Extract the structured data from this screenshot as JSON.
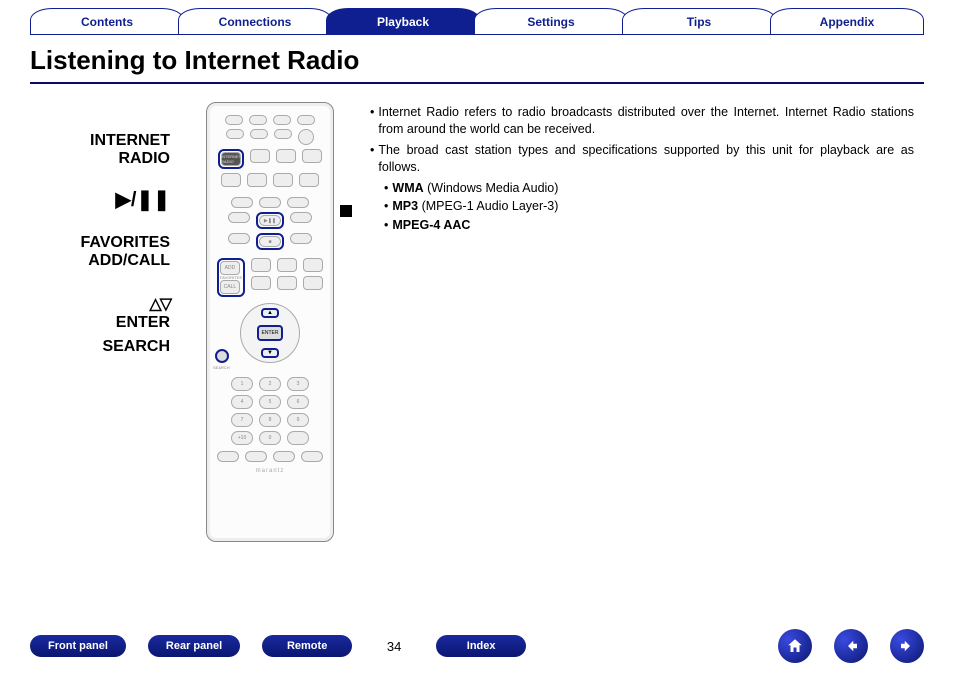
{
  "tabs": [
    {
      "label": "Contents",
      "active": false
    },
    {
      "label": "Connections",
      "active": false
    },
    {
      "label": "Playback",
      "active": true
    },
    {
      "label": "Settings",
      "active": false
    },
    {
      "label": "Tips",
      "active": false
    },
    {
      "label": "Appendix",
      "active": false
    }
  ],
  "title": "Listening to Internet Radio",
  "left_labels": {
    "internet": "INTERNET",
    "radio": "RADIO",
    "playpause": "▶/❚❚",
    "favorites": "FAVORITES",
    "addcall": "ADD/CALL",
    "triangles": "△▽",
    "enter": "ENTER",
    "search": "SEARCH"
  },
  "remote_text": {
    "internet_radio": "INTERNET RADIO",
    "add": "ADD",
    "favorites_lbl": "FAVORITES",
    "call": "CALL",
    "enter": "ENTER",
    "up": "▲",
    "down": "▼",
    "search_lbl": "SEARCH",
    "brand": "marantz"
  },
  "body": {
    "p1": "Internet Radio refers to radio broadcasts distributed over the Internet. Internet Radio stations from around the world can be received.",
    "p2": "The broad cast station types and specifications supported by this unit for playback are as follows.",
    "f1b": "WMA",
    "f1r": " (Windows Media Audio)",
    "f2b": "MP3",
    "f2r": " (MPEG-1 Audio Layer-3)",
    "f3b": "MPEG-4 AAC"
  },
  "footer": {
    "front": "Front panel",
    "rear": "Rear panel",
    "remote": "Remote",
    "page": "34",
    "index": "Index"
  }
}
